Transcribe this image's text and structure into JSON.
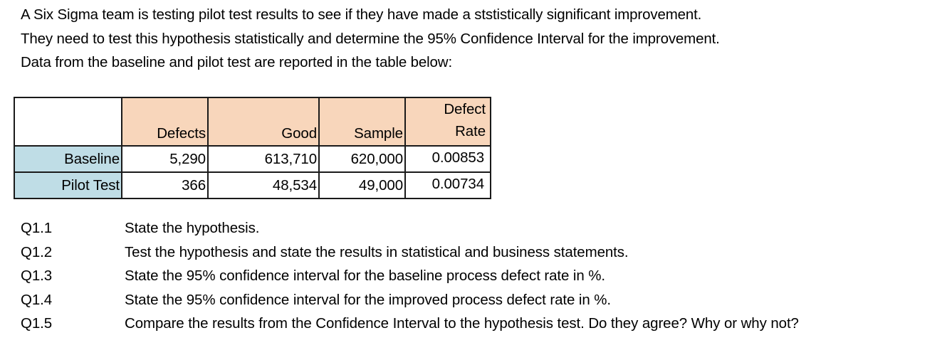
{
  "intro": {
    "lines": [
      "A Six Sigma team is testing pilot test results to see if they have made a ststistically significant improvement.",
      "They need to test this hypothesis statistically and determine the 95% Confidence Interval for the improvement.",
      "Data from the baseline and pilot test are reported in the table below:"
    ]
  },
  "table": {
    "headers": {
      "corner": "",
      "defects": "Defects",
      "good": "Good",
      "sample": "Sample",
      "defect_rate_line1": "Defect",
      "defect_rate_line2": "Rate"
    },
    "rows": [
      {
        "label": "Baseline",
        "defects": "5,290",
        "good": "613,710",
        "sample": "620,000",
        "defect_rate": "0.00853"
      },
      {
        "label": "Pilot Test",
        "defects": "366",
        "good": "48,534",
        "sample": "49,000",
        "defect_rate": "0.00734"
      }
    ],
    "colors": {
      "header_fill": "#f8d6bb",
      "label_fill": "#bfdde6",
      "border": "#1a1a1a"
    }
  },
  "questions": [
    {
      "number": "Q1.1",
      "text": "State the hypothesis."
    },
    {
      "number": "Q1.2",
      "text": "Test the hypothesis and state the results in statistical and business statements."
    },
    {
      "number": "Q1.3",
      "text": "State the 95% confidence interval for the baseline process defect rate in %."
    },
    {
      "number": "Q1.4",
      "text": "State the 95% confidence interval for the improved process defect rate in %."
    },
    {
      "number": "Q1.5",
      "text": "Compare the results from the Confidence Interval to the hypothesis test. Do they agree? Why or why not?"
    }
  ]
}
